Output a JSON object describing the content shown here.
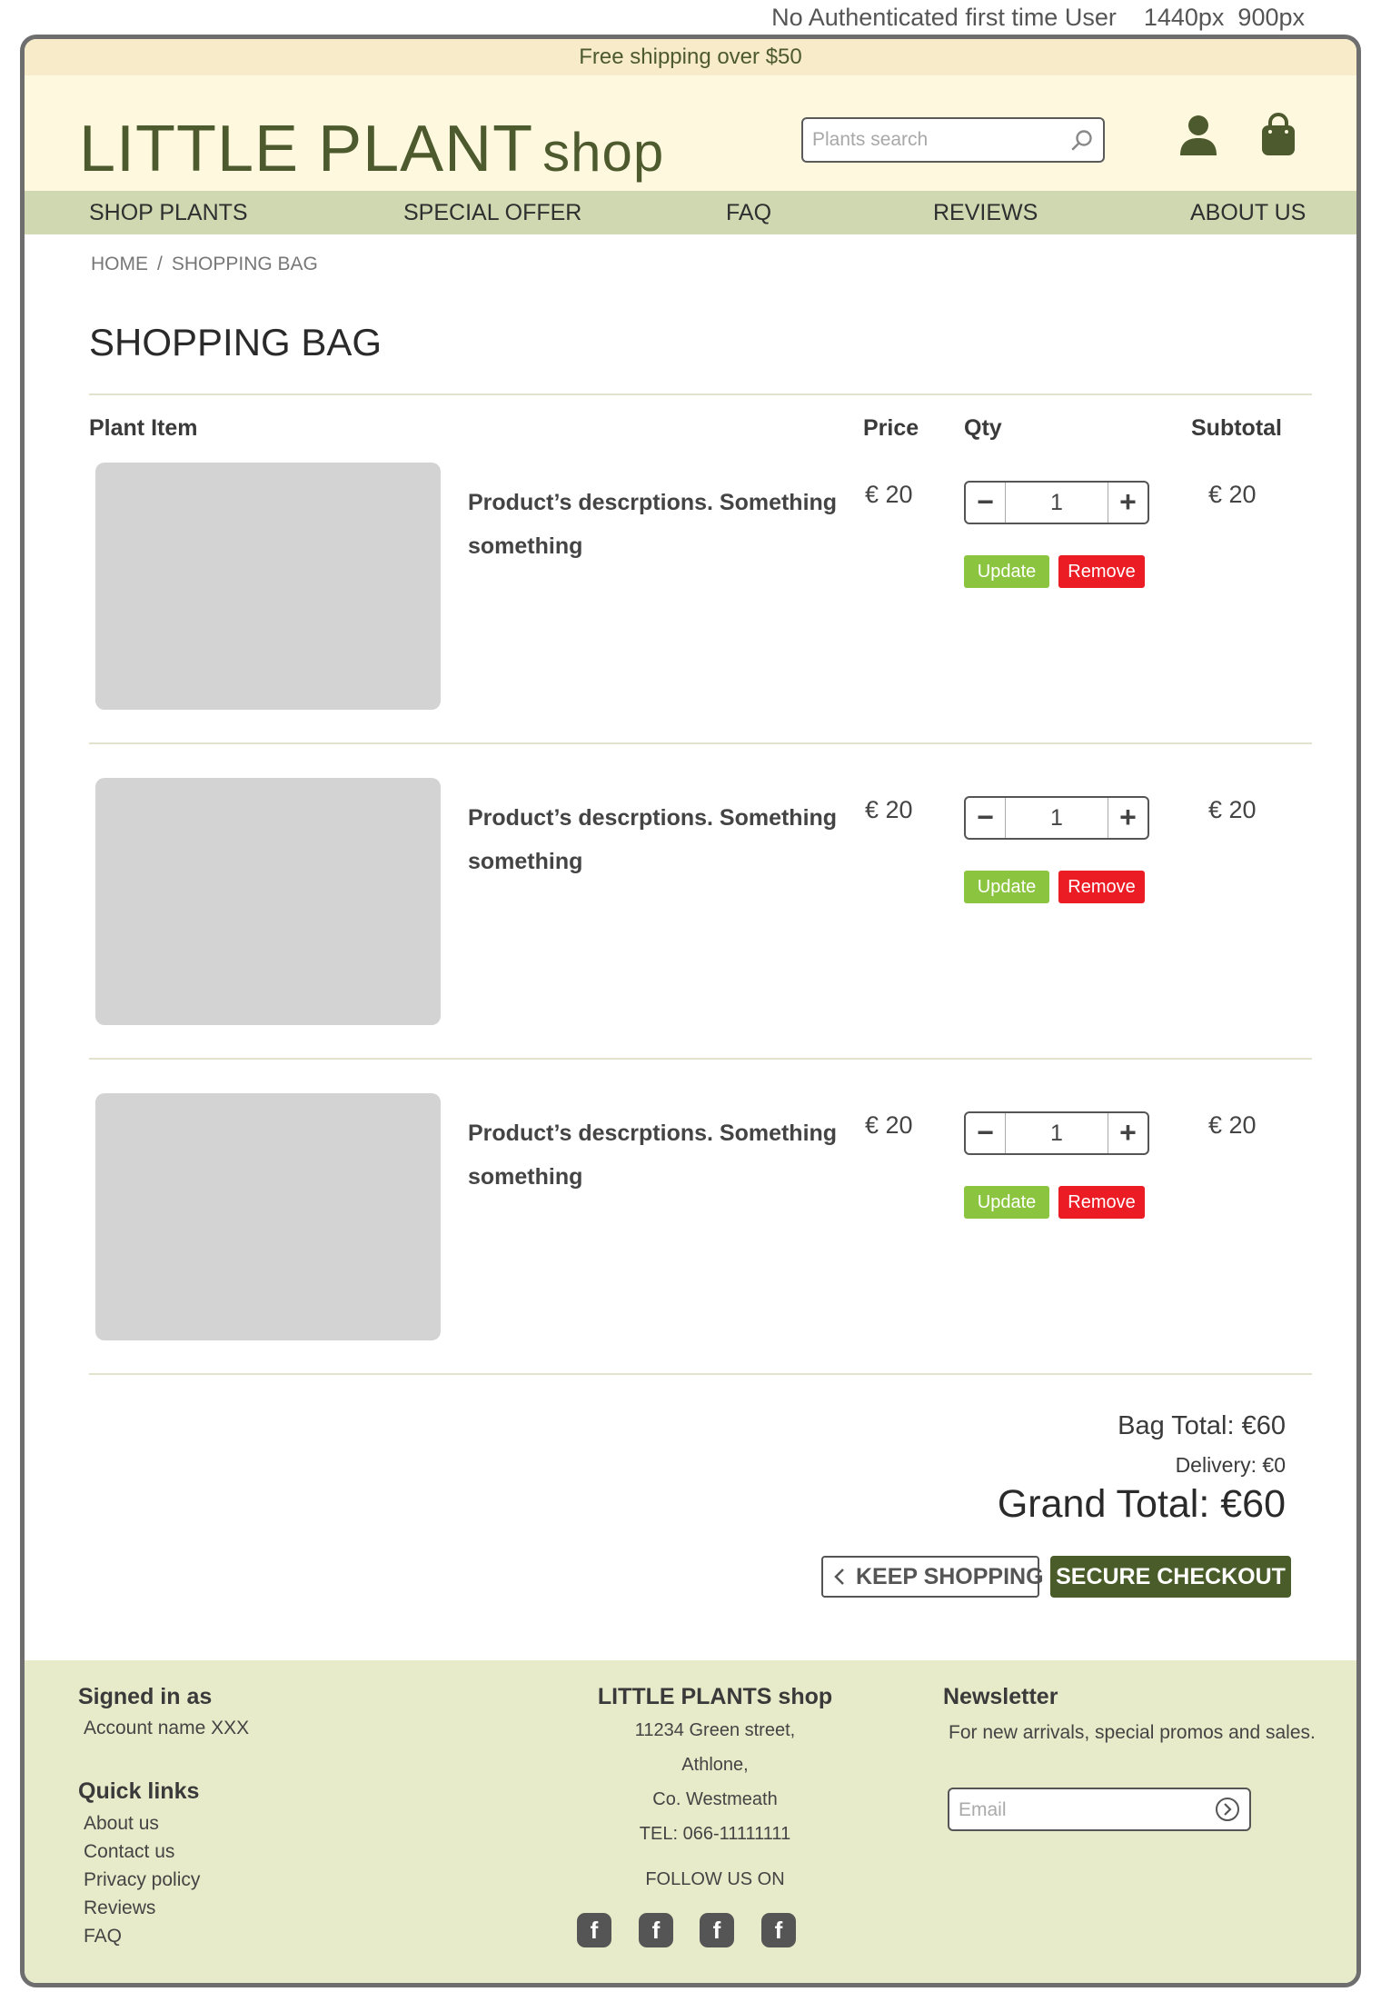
{
  "annotation": "No Authenticated first time User    1440px  900px",
  "promo": "Free shipping over $50",
  "brand": {
    "name": "LITTLE PLANT",
    "suffix": "shop"
  },
  "search": {
    "placeholder": "Plants search",
    "value": ""
  },
  "nav": [
    "SHOP PLANTS",
    "SPECIAL OFFER",
    "FAQ",
    "REVIEWS",
    "ABOUT US"
  ],
  "breadcrumb": {
    "home": "HOME",
    "sep": "/",
    "current": "SHOPPING BAG"
  },
  "page_title": "SHOPPING BAG",
  "columns": {
    "item": "Plant Item",
    "price": "Price",
    "qty": "Qty",
    "subtotal": "Subtotal"
  },
  "items": [
    {
      "description": "Product’s descrptions. Something something",
      "price": "€ 20",
      "qty": "1",
      "subtotal": "€ 20"
    },
    {
      "description": "Product’s descrptions. Something something",
      "price": "€ 20",
      "qty": "1",
      "subtotal": "€ 20"
    },
    {
      "description": "Product’s descrptions. Something something",
      "price": "€ 20",
      "qty": "1",
      "subtotal": "€ 20"
    }
  ],
  "item_actions": {
    "minus": "−",
    "plus": "+",
    "update": "Update",
    "remove": "Remove"
  },
  "totals": {
    "bag_total": "Bag Total: €60",
    "delivery": "Delivery: €0",
    "grand_total": "Grand Total: €60"
  },
  "buttons": {
    "keep_shopping": "KEEP SHOPPING",
    "secure_checkout": "SECURE CHECKOUT"
  },
  "footer": {
    "signed_in_heading": "Signed in as",
    "account_name": "Account name XXX",
    "quick_links_heading": "Quick links",
    "quick_links": [
      "About us",
      "Contact us",
      "Privacy policy",
      "Reviews",
      "FAQ"
    ],
    "shop_name": "LITTLE PLANTS shop",
    "address": [
      "11234 Green street,",
      "Athlone,",
      "Co. Westmeath",
      "TEL: 066-11111111"
    ],
    "follow": "FOLLOW US ON",
    "social_icon": "f",
    "newsletter_heading": "Newsletter",
    "newsletter_text": "For new arrivals, special promos and sales.",
    "email_placeholder": "Email"
  },
  "colors": {
    "promo_bg": "#f7ebc9",
    "header_bg": "#fdf8de",
    "nav_bg": "#d0d8b2",
    "brand_green": "#4d5a2d",
    "update_green": "#8bc53f",
    "remove_red": "#ec1c24",
    "checkout_green": "#4a5c2a",
    "footer_bg": "#e7ebc9"
  },
  "icons": {
    "search": "search-icon",
    "user": "user-icon",
    "bag": "shopping-bag-icon",
    "back": "chevron-left-icon",
    "submit": "arrow-right-circle-icon",
    "social": "facebook-icon"
  }
}
